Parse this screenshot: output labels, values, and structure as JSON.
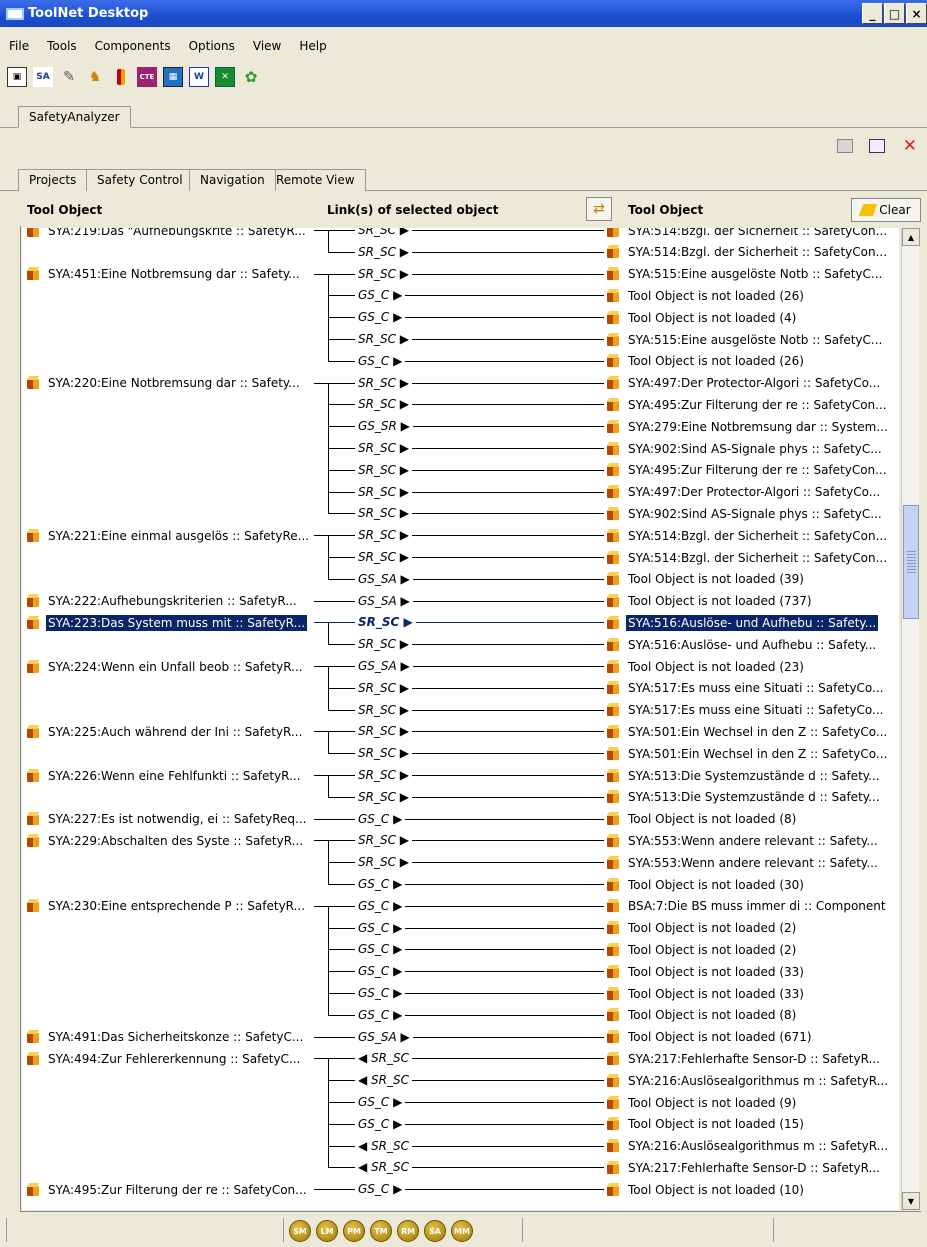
{
  "window": {
    "title": "ToolNet Desktop",
    "buttons": [
      "_",
      "□",
      "×"
    ]
  },
  "menu": [
    "File",
    "Tools",
    "Components",
    "Options",
    "View",
    "Help"
  ],
  "toolbar_icons": [
    "pm-icon",
    "sa-icon",
    "pen-icon",
    "person-icon",
    "battery-icon",
    "cte-icon",
    "chart-icon",
    "word-icon",
    "excel-icon",
    "flower-icon"
  ],
  "toolbar_text": {
    "sa": "SA",
    "cte": "CTE",
    "word": "W"
  },
  "app_tab": "SafetyAnalyzer",
  "sub_tabs": [
    "Projects",
    "Safety Control",
    "Navigation",
    "Remote View"
  ],
  "active_sub_tab": "Navigation",
  "headers": {
    "left": "Tool Object",
    "middle": "Link(s) of selected object",
    "right": "Tool Object",
    "clear": "Clear"
  },
  "rows": [
    {
      "left": "SYA:219:Das \"Aufhebungskrite :: SafetyR...",
      "link": "SR_SC ▶",
      "right": "SYA:514:Bzgl. der Sicherheit :: SafetyCon..."
    },
    {
      "left": "",
      "link": "SR_SC ▶",
      "right": "SYA:514:Bzgl. der Sicherheit :: SafetyCon..."
    },
    {
      "left": "SYA:451:Eine Notbremsung dar :: Safety...",
      "link": "SR_SC ▶",
      "right": "SYA:515:Eine ausgelöste Notb :: SafetyC..."
    },
    {
      "left": "",
      "link": "GS_C ▶",
      "right": "Tool Object is not loaded (26)"
    },
    {
      "left": "",
      "link": "GS_C ▶",
      "right": "Tool Object is not loaded (4)"
    },
    {
      "left": "",
      "link": "SR_SC ▶",
      "right": "SYA:515:Eine ausgelöste Notb :: SafetyC..."
    },
    {
      "left": "",
      "link": "GS_C ▶",
      "right": "Tool Object is not loaded (26)"
    },
    {
      "left": "SYA:220:Eine Notbremsung dar :: Safety...",
      "link": "SR_SC ▶",
      "right": "SYA:497:Der Protector-Algori :: SafetyCo..."
    },
    {
      "left": "",
      "link": "SR_SC ▶",
      "right": "SYA:495:Zur Filterung der re :: SafetyCon..."
    },
    {
      "left": "",
      "link": "GS_SR ▶",
      "right": "SYA:279:Eine Notbremsung dar :: System..."
    },
    {
      "left": "",
      "link": "SR_SC ▶",
      "right": "SYA:902:Sind AS-Signale phys :: SafetyC..."
    },
    {
      "left": "",
      "link": "SR_SC ▶",
      "right": "SYA:495:Zur Filterung der re :: SafetyCon..."
    },
    {
      "left": "",
      "link": "SR_SC ▶",
      "right": "SYA:497:Der Protector-Algori :: SafetyCo..."
    },
    {
      "left": "",
      "link": "SR_SC ▶",
      "right": "SYA:902:Sind AS-Signale phys :: SafetyC..."
    },
    {
      "left": "SYA:221:Eine einmal ausgelös :: SafetyRe...",
      "link": "SR_SC ▶",
      "right": "SYA:514:Bzgl. der Sicherheit :: SafetyCon..."
    },
    {
      "left": "",
      "link": "SR_SC ▶",
      "right": "SYA:514:Bzgl. der Sicherheit :: SafetyCon..."
    },
    {
      "left": "",
      "link": "GS_SA ▶",
      "right": "Tool Object is not loaded (39)"
    },
    {
      "left": "SYA:222:Aufhebungskriterien :: SafetyR...",
      "link": "GS_SA ▶",
      "right": "Tool Object is not loaded (737)"
    },
    {
      "left": "SYA:223:Das System muss mit :: SafetyR...",
      "link": "SR_SC ▶",
      "right": "SYA:516:Auslöse- und Aufhebu :: Safety...",
      "selected": true
    },
    {
      "left": "",
      "link": "SR_SC ▶",
      "right": "SYA:516:Auslöse- und Aufhebu :: Safety..."
    },
    {
      "left": "SYA:224:Wenn ein Unfall beob :: SafetyR...",
      "link": "GS_SA ▶",
      "right": "Tool Object is not loaded (23)"
    },
    {
      "left": "",
      "link": "SR_SC ▶",
      "right": "SYA:517:Es muss eine Situati :: SafetyCo..."
    },
    {
      "left": "",
      "link": "SR_SC ▶",
      "right": "SYA:517:Es muss eine Situati :: SafetyCo..."
    },
    {
      "left": "SYA:225:Auch während der Ini :: SafetyR...",
      "link": "SR_SC ▶",
      "right": "SYA:501:Ein Wechsel in den Z :: SafetyCo..."
    },
    {
      "left": "",
      "link": "SR_SC ▶",
      "right": "SYA:501:Ein Wechsel in den Z :: SafetyCo..."
    },
    {
      "left": "SYA:226:Wenn eine Fehlfunkti :: SafetyR...",
      "link": "SR_SC ▶",
      "right": "SYA:513:Die Systemzustände d :: Safety..."
    },
    {
      "left": "",
      "link": "SR_SC ▶",
      "right": "SYA:513:Die Systemzustände d :: Safety..."
    },
    {
      "left": "SYA:227:Es ist notwendig, ei :: SafetyReq...",
      "link": "GS_C ▶",
      "right": "Tool Object is not loaded (8)"
    },
    {
      "left": "SYA:229:Abschalten des Syste :: SafetyR...",
      "link": "SR_SC ▶",
      "right": "SYA:553:Wenn andere relevant :: Safety..."
    },
    {
      "left": "",
      "link": "SR_SC ▶",
      "right": "SYA:553:Wenn andere relevant :: Safety..."
    },
    {
      "left": "",
      "link": "GS_C ▶",
      "right": "Tool Object is not loaded (30)"
    },
    {
      "left": "SYA:230:Eine entsprechende P :: SafetyR...",
      "link": "GS_C ▶",
      "right": "BSA:7:Die BS muss immer di :: Component"
    },
    {
      "left": "",
      "link": "GS_C ▶",
      "right": "Tool Object is not loaded (2)"
    },
    {
      "left": "",
      "link": "GS_C ▶",
      "right": "Tool Object is not loaded (2)"
    },
    {
      "left": "",
      "link": "GS_C ▶",
      "right": "Tool Object is not loaded (33)"
    },
    {
      "left": "",
      "link": "GS_C ▶",
      "right": "Tool Object is not loaded (33)"
    },
    {
      "left": "",
      "link": "GS_C ▶",
      "right": "Tool Object is not loaded (8)"
    },
    {
      "left": "SYA:491:Das Sicherheitskonze :: SafetyC...",
      "link": "GS_SA ▶",
      "right": "Tool Object is not loaded (671)"
    },
    {
      "left": "SYA:494:Zur Fehlererkennung :: SafetyC...",
      "link": "◀ SR_SC",
      "right": "SYA:217:Fehlerhafte Sensor-D :: SafetyR..."
    },
    {
      "left": "",
      "link": "◀ SR_SC",
      "right": "SYA:216:Auslösealgorithmus m :: SafetyR..."
    },
    {
      "left": "",
      "link": "GS_C ▶",
      "right": "Tool Object is not loaded (9)"
    },
    {
      "left": "",
      "link": "GS_C ▶",
      "right": "Tool Object is not loaded (15)"
    },
    {
      "left": "",
      "link": "◀ SR_SC",
      "right": "SYA:216:Auslösealgorithmus m :: SafetyR..."
    },
    {
      "left": "",
      "link": "◀ SR_SC",
      "right": "SYA:217:Fehlerhafte Sensor-D :: SafetyR..."
    },
    {
      "left": "SYA:495:Zur Filterung der re :: SafetyCon...",
      "link": "GS_C ▶",
      "right": "Tool Object is not loaded (10)"
    }
  ],
  "status_badges": [
    "SM",
    "LM",
    "PM",
    "TM",
    "RM",
    "SA",
    "MM"
  ]
}
